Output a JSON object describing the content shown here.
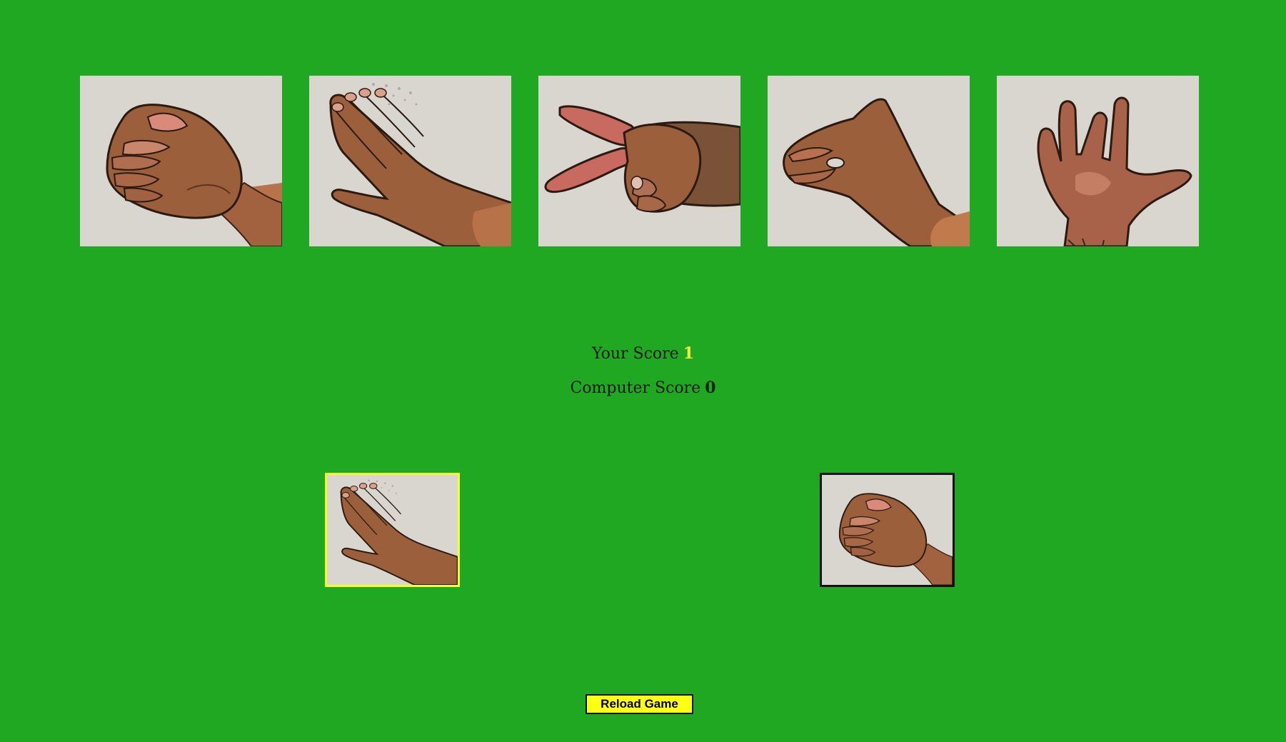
{
  "choices": [
    {
      "name": "rock",
      "icon": "rock-hand-icon"
    },
    {
      "name": "paper",
      "icon": "paper-hand-icon"
    },
    {
      "name": "scissors",
      "icon": "scissors-hand-icon"
    },
    {
      "name": "lizard",
      "icon": "lizard-hand-icon"
    },
    {
      "name": "spock",
      "icon": "spock-hand-icon"
    }
  ],
  "scoreboard": {
    "your_label": "Your Score",
    "your_value": "1",
    "computer_label": "Computer Score",
    "computer_value": "0"
  },
  "round": {
    "player_pick": "paper",
    "computer_pick": "rock"
  },
  "reload_label": "Reload Game",
  "colors": {
    "background": "#21a822",
    "highlight": "#f5ff2e",
    "button": "#ffff14",
    "card": "#d9d6cf",
    "skin": "#9c5f3c"
  }
}
